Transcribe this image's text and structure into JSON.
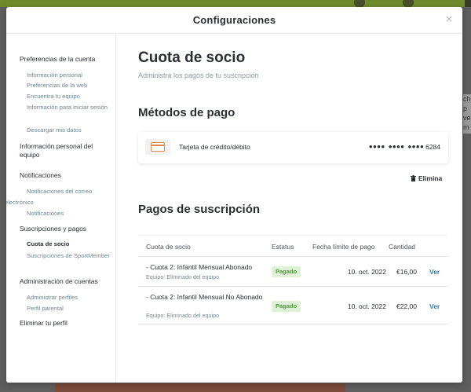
{
  "modal": {
    "title": "Configuraciones",
    "close_glyph": "×"
  },
  "background": {
    "right_text": "ch p ve m"
  },
  "sidebar": {
    "sections": [
      {
        "label": "Preferencias de la cuenta",
        "items": [
          "Información personal",
          "Preferencias de la web",
          "Encuentra tu equipo",
          "Información para iniciar sesión",
          "Descargar mis datos"
        ]
      },
      {
        "label": "Información personal del equipo",
        "items": []
      },
      {
        "label": "Notificaciones",
        "items": [
          "Notificaciones del correo electrónico",
          "Notificaciones"
        ]
      },
      {
        "label": "Suscripciones y pagos",
        "items": [
          "Cuota de socio",
          "Suscripciones de SportMember"
        ]
      },
      {
        "label": "Administración de cuentas",
        "items": [
          "Administrar perfiles",
          "Perfil parental"
        ]
      },
      {
        "label": "Eliminar tu perfil",
        "items": []
      }
    ],
    "active_item": "Cuota de socio"
  },
  "main": {
    "title": "Cuota de socio",
    "subtitle": "Administra los pagos de tu suscripción",
    "methods": {
      "heading": "Métodos de pago",
      "card_label": "Tarjeta de crédito/débito",
      "card_mask": "•••• •••• ••••",
      "card_last4": "6284",
      "delete_label": "Elimina",
      "icon": "credit-card-icon",
      "icon_color": "#e08a4a"
    },
    "payments": {
      "heading": "Pagos de suscripción",
      "columns": [
        "Cuota de socio",
        "Estatus",
        "Fecha límite de pago",
        "Cantidad"
      ],
      "rows": [
        {
          "name": "- Cuota 2: Infantil Mensual Abonado",
          "team": "Equipo: Eliminado del equipo",
          "status": "Pagado",
          "due": "10. oct. 2022",
          "amount": "€16,00",
          "action": "Ver"
        },
        {
          "name": "- Cuota 2: Infantil Mensual No Abonado",
          "team": "Equipo: Eliminado del equipo",
          "status": "Pagado",
          "due": "10. oct. 2022",
          "amount": "€22,00",
          "action": "Ver"
        }
      ]
    }
  },
  "colors": {
    "link": "#2f7fb0",
    "badge_bg": "#dff2d8",
    "badge_text": "#4f9a3a",
    "muted": "#6f8590"
  }
}
